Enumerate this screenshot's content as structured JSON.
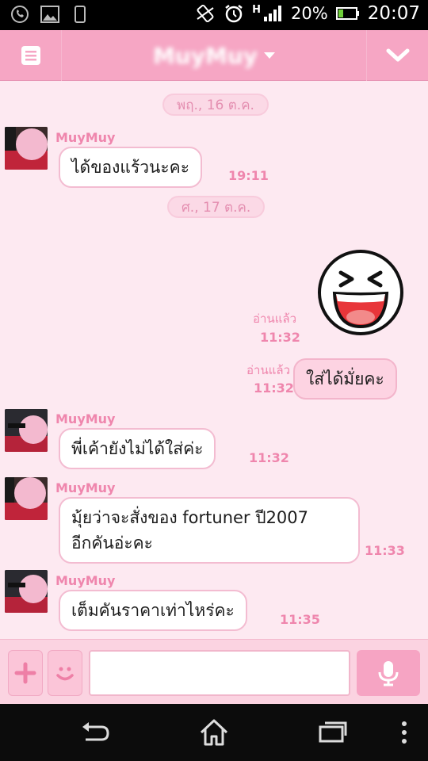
{
  "status_bar": {
    "icons_left": [
      "whatsapp-icon",
      "gallery-icon",
      "phone-icon"
    ],
    "network_type": "H",
    "battery": "20%",
    "time": "20:07"
  },
  "header": {
    "title": "MuyMuy"
  },
  "messages": {
    "date1": "พฤ., 16 ต.ค.",
    "m1": {
      "sender": "MuyMuy",
      "text": "ได้ของแร้วนะคะ",
      "time": "19:11"
    },
    "date2": "ศ., 17 ต.ค.",
    "sticker": {
      "read": "อ่านแล้ว",
      "time": "11:32"
    },
    "m2": {
      "read": "อ่านแล้ว",
      "time": "11:32",
      "text": "ใส่ได้มั่ยคะ"
    },
    "m3": {
      "sender": "MuyMuy",
      "text": "พี่เค้ายังไม่ได้ใส่ค่ะ",
      "time": "11:32"
    },
    "m4": {
      "sender": "MuyMuy",
      "line1": "มุ้ยว่าจะสั่งของ fortuner ปี2007",
      "line2": "อีกคันอ่ะคะ",
      "time": "11:33"
    },
    "m5": {
      "sender": "MuyMuy",
      "text": "เต็มคันราคาเท่าไหร่คะ",
      "time": "11:35"
    }
  },
  "input": {
    "placeholder": ""
  },
  "colors": {
    "header": "#f6a6c4",
    "chat_bg": "#fde9f1",
    "accent": "#ef86ad"
  }
}
